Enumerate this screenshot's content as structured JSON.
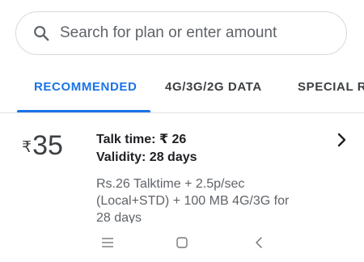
{
  "search": {
    "placeholder": "Search for plan or enter amount",
    "icon": "search-icon"
  },
  "tabs": [
    {
      "label": "RECOMMENDED",
      "active": true
    },
    {
      "label": "4G/3G/2G DATA",
      "active": false
    },
    {
      "label": "SPECIAL R",
      "active": false
    }
  ],
  "plan": {
    "currency": "₹",
    "amount": "35",
    "talk_time": "Talk time: ₹ 26",
    "validity": "Validity: 28 days",
    "description": "Rs.26 Talktime + 2.5p/sec (Local+STD) + 100 MB 4G/3G for 28 days",
    "action_icon": "chevron-right-icon"
  },
  "navbar": {
    "icons": [
      "menu-icon",
      "home-icon",
      "back-icon"
    ]
  },
  "colors": {
    "accent": "#1a73e8",
    "text_primary": "#202124",
    "text_secondary": "#5f6368"
  }
}
